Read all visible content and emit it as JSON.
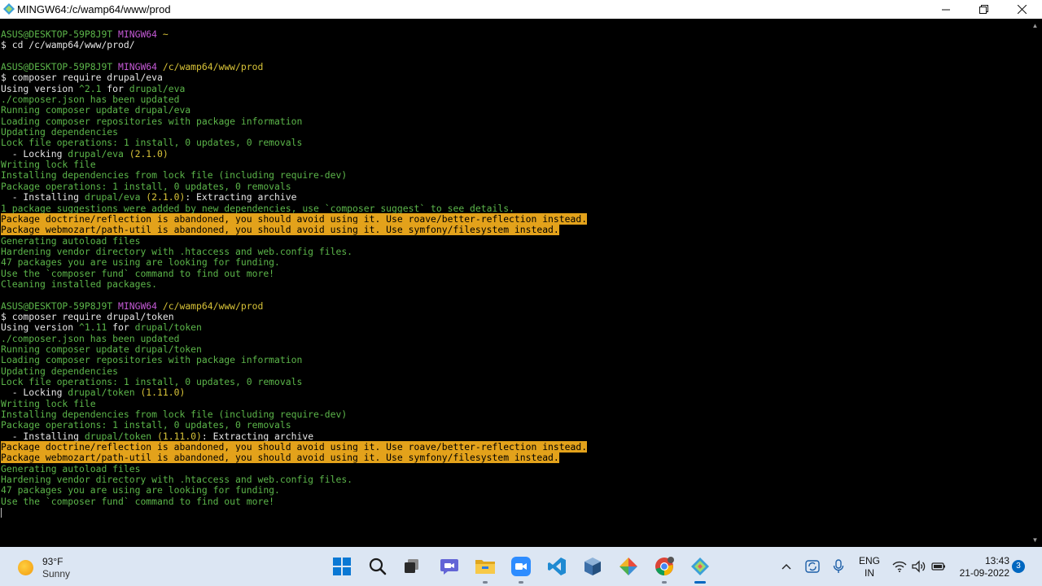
{
  "window": {
    "title": "MINGW64:/c/wamp64/www/prod"
  },
  "terminal": {
    "lines": [
      [
        {
          "t": "ASUS@DESKTOP-59P8J9T ",
          "c": "g"
        },
        {
          "t": "MINGW64 ",
          "c": "m"
        },
        {
          "t": "~",
          "c": "y"
        }
      ],
      [
        {
          "t": "$ cd /c/wamp64/www/prod/",
          "c": "w"
        }
      ],
      [],
      [
        {
          "t": "ASUS@DESKTOP-59P8J9T ",
          "c": "g"
        },
        {
          "t": "MINGW64 ",
          "c": "m"
        },
        {
          "t": "/c/wamp64/www/prod",
          "c": "y"
        }
      ],
      [
        {
          "t": "$ composer require drupal/eva",
          "c": "w"
        }
      ],
      [
        {
          "t": "Using version ",
          "c": "w"
        },
        {
          "t": "^2.1",
          "c": "g"
        },
        {
          "t": " for ",
          "c": "w"
        },
        {
          "t": "drupal/eva",
          "c": "g"
        }
      ],
      [
        {
          "t": "./composer.json has been updated",
          "c": "g"
        }
      ],
      [
        {
          "t": "Running composer update drupal/eva",
          "c": "g"
        }
      ],
      [
        {
          "t": "Loading composer repositories with package information",
          "c": "g"
        }
      ],
      [
        {
          "t": "Updating dependencies",
          "c": "g"
        }
      ],
      [
        {
          "t": "Lock file operations: 1 install, 0 updates, 0 removals",
          "c": "g"
        }
      ],
      [
        {
          "t": "  - Locking ",
          "c": "w"
        },
        {
          "t": "drupal/eva",
          "c": "g"
        },
        {
          "t": " (2.1.0)",
          "c": "y"
        }
      ],
      [
        {
          "t": "Writing lock file",
          "c": "g"
        }
      ],
      [
        {
          "t": "Installing dependencies from lock file (including require-dev)",
          "c": "g"
        }
      ],
      [
        {
          "t": "Package operations: 1 install, 0 updates, 0 removals",
          "c": "g"
        }
      ],
      [
        {
          "t": "  - Installing ",
          "c": "w"
        },
        {
          "t": "drupal/eva",
          "c": "g"
        },
        {
          "t": " (2.1.0)",
          "c": "y"
        },
        {
          "t": ": Extracting archive",
          "c": "w"
        }
      ],
      [
        {
          "t": "1 package suggestions were added by new dependencies, use `composer suggest` to see details.",
          "c": "g"
        }
      ],
      [
        {
          "t": "Package doctrine/reflection is abandoned, you should avoid using it. Use roave/better-reflection instead.",
          "c": "hl"
        }
      ],
      [
        {
          "t": "Package webmozart/path-util is abandoned, you should avoid using it. Use symfony/filesystem instead.",
          "c": "hl"
        }
      ],
      [
        {
          "t": "Generating autoload files",
          "c": "g"
        }
      ],
      [
        {
          "t": "Hardening vendor directory with .htaccess and web.config files.",
          "c": "g"
        }
      ],
      [
        {
          "t": "47 packages you are using are looking for funding.",
          "c": "g"
        }
      ],
      [
        {
          "t": "Use the `composer fund` command to find out more!",
          "c": "g"
        }
      ],
      [
        {
          "t": "Cleaning installed packages.",
          "c": "g"
        }
      ],
      [],
      [
        {
          "t": "ASUS@DESKTOP-59P8J9T ",
          "c": "g"
        },
        {
          "t": "MINGW64 ",
          "c": "m"
        },
        {
          "t": "/c/wamp64/www/prod",
          "c": "y"
        }
      ],
      [
        {
          "t": "$ composer require drupal/token",
          "c": "w"
        }
      ],
      [
        {
          "t": "Using version ",
          "c": "w"
        },
        {
          "t": "^1.11",
          "c": "g"
        },
        {
          "t": " for ",
          "c": "w"
        },
        {
          "t": "drupal/token",
          "c": "g"
        }
      ],
      [
        {
          "t": "./composer.json has been updated",
          "c": "g"
        }
      ],
      [
        {
          "t": "Running composer update drupal/token",
          "c": "g"
        }
      ],
      [
        {
          "t": "Loading composer repositories with package information",
          "c": "g"
        }
      ],
      [
        {
          "t": "Updating dependencies",
          "c": "g"
        }
      ],
      [
        {
          "t": "Lock file operations: 1 install, 0 updates, 0 removals",
          "c": "g"
        }
      ],
      [
        {
          "t": "  - Locking ",
          "c": "w"
        },
        {
          "t": "drupal/token",
          "c": "g"
        },
        {
          "t": " (1.11.0)",
          "c": "y"
        }
      ],
      [
        {
          "t": "Writing lock file",
          "c": "g"
        }
      ],
      [
        {
          "t": "Installing dependencies from lock file (including require-dev)",
          "c": "g"
        }
      ],
      [
        {
          "t": "Package operations: 1 install, 0 updates, 0 removals",
          "c": "g"
        }
      ],
      [
        {
          "t": "  - Installing ",
          "c": "w"
        },
        {
          "t": "drupal/token",
          "c": "g"
        },
        {
          "t": " (1.11.0)",
          "c": "y"
        },
        {
          "t": ": Extracting archive",
          "c": "w"
        }
      ],
      [
        {
          "t": "Package doctrine/reflection is abandoned, you should avoid using it. Use roave/better-reflection instead.",
          "c": "hl"
        }
      ],
      [
        {
          "t": "Package webmozart/path-util is abandoned, you should avoid using it. Use symfony/filesystem instead.",
          "c": "hl"
        }
      ],
      [
        {
          "t": "Generating autoload files",
          "c": "g"
        }
      ],
      [
        {
          "t": "Hardening vendor directory with .htaccess and web.config files.",
          "c": "g"
        }
      ],
      [
        {
          "t": "47 packages you are using are looking for funding.",
          "c": "g"
        }
      ],
      [
        {
          "t": "Use the `composer fund` command to find out more!",
          "c": "g"
        }
      ]
    ]
  },
  "colors": {
    "text_white": "#e6e6e6",
    "text_green": "#5cb64a",
    "text_magenta": "#c55ad6",
    "text_yellow": "#d8c338",
    "highlight_bg": "#e3a21b",
    "taskbar_bg": "#dce6f3",
    "accent_blue": "#0067c0"
  },
  "taskbar": {
    "weather": {
      "temp": "93°F",
      "condition": "Sunny",
      "icon": "sun-icon"
    },
    "apps": [
      {
        "name": "start-button",
        "icon": "windows-logo-icon"
      },
      {
        "name": "search-button",
        "icon": "search-icon"
      },
      {
        "name": "task-view-button",
        "icon": "task-view-icon"
      },
      {
        "name": "chat-button",
        "icon": "chat-icon"
      },
      {
        "name": "file-explorer-button",
        "icon": "folder-icon"
      },
      {
        "name": "zoom-button",
        "icon": "zoom-camera-icon"
      },
      {
        "name": "vscode-button",
        "icon": "vscode-icon"
      },
      {
        "name": "virtualbox-button",
        "icon": "cube-icon"
      },
      {
        "name": "git-gui-button",
        "icon": "git-diamond-icon"
      },
      {
        "name": "chrome-button",
        "icon": "chrome-icon"
      },
      {
        "name": "git-bash-button",
        "icon": "git-bash-icon"
      }
    ],
    "tray": {
      "language": {
        "line1": "ENG",
        "line2": "IN"
      },
      "time": "13:43",
      "date": "21-09-2022",
      "notification_count": "3"
    }
  }
}
